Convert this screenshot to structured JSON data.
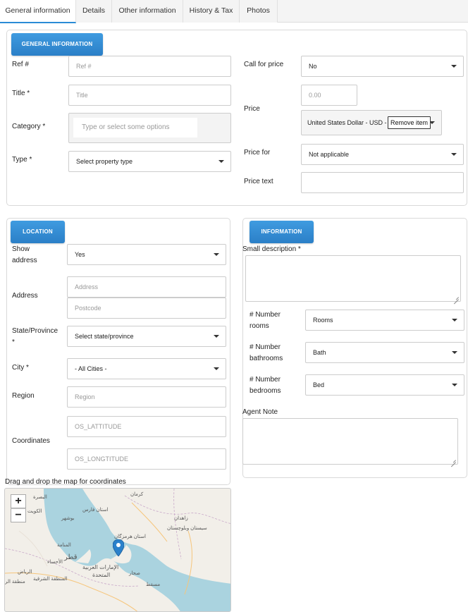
{
  "tabs": [
    "General information",
    "Details",
    "Other information",
    "History & Tax",
    "Photos"
  ],
  "general": {
    "header": "GENERAL INFORMATION",
    "ref_label": "Ref #",
    "ref_placeholder": "Ref #",
    "title_label": "Title *",
    "title_placeholder": "Title",
    "category_label": "Category *",
    "category_placeholder": "Type or select some options",
    "type_label": "Type *",
    "type_value": "Select property type",
    "call_for_price_label": "Call for price",
    "call_for_price_value": "No",
    "price_label": "Price",
    "price_placeholder": "0.00",
    "currency_value": "United States Dollar - USD - $",
    "remove_item_label": "Remove item",
    "price_for_label": "Price for",
    "price_for_value": "Not applicable",
    "price_text_label": "Price text"
  },
  "location": {
    "header": "LOCATION",
    "show_address_label_1": "Show",
    "show_address_label_2": "address",
    "show_address_value": "Yes",
    "address_label": "Address",
    "address_placeholder": "Address",
    "postcode_placeholder": "Postcode",
    "state_label_1": "State/Province",
    "state_label_2": "*",
    "state_value": "Select state/province",
    "city_label": "City *",
    "city_value": "- All Cities -",
    "region_label": "Region",
    "region_placeholder": "Region",
    "coordinates_label": "Coordinates",
    "lat_placeholder": "OS_LATTITUDE",
    "lng_placeholder": "OS_LONGTITUDE",
    "map_hint": "Drag and drop the map for coordinates",
    "zoom_in": "+",
    "zoom_out": "−",
    "map_labels": [
      "کرمان",
      "البصرة",
      "الكويت",
      "استان فارس",
      "بوشهر",
      "زاهدان",
      "استان هرمزگان",
      "المنامة",
      "قطر",
      "الإمارات العربية",
      "المتحدة",
      "الأحساء",
      "الرياض",
      "المنطقة الشرقية",
      "منطقة الر",
      "صحار",
      "مسقط",
      "سيستان وبلوچستان"
    ]
  },
  "information": {
    "header": "INFORMATION",
    "small_description_label": "Small description *",
    "rooms_label_1": "# Number",
    "rooms_label_2": "rooms",
    "rooms_value": "Rooms",
    "bathrooms_label_1": "# Number",
    "bathrooms_label_2": "bathrooms",
    "bathrooms_value": "Bath",
    "bedrooms_label_1": "# Number",
    "bedrooms_label_2": "bedrooms",
    "bedrooms_value": "Bed",
    "agent_note_label": "Agent Note"
  },
  "colors": {
    "accent": "#2b87d3",
    "map_water": "#aad3df",
    "map_land": "#f2efe9",
    "marker": "#2a81cb"
  }
}
